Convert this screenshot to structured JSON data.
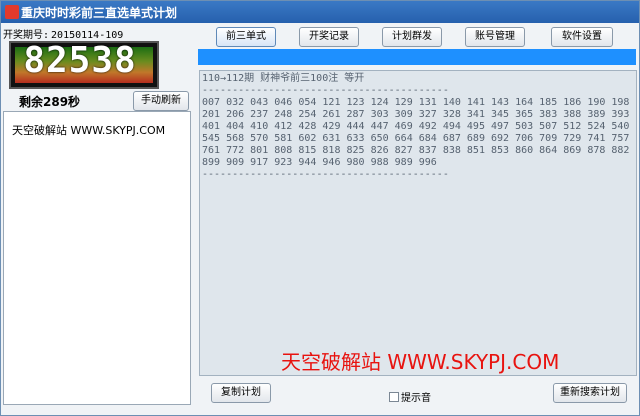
{
  "window": {
    "title": "重庆时时彩前三直选单式计划"
  },
  "draw": {
    "label": "开奖期号:",
    "value": "20150114-109",
    "number": "82538",
    "remaining": "剩余289秒"
  },
  "buttons": {
    "refresh": "手动刷新",
    "tabs": [
      "前三单式",
      "开奖记录",
      "计划群发",
      "账号管理",
      "软件设置"
    ],
    "copy_plan": "复制计划",
    "re_search": "重新搜索计划"
  },
  "left": {
    "text": "天空破解站 WWW.SKYPJ.COM"
  },
  "plan": {
    "header": "110→112期  财神爷前三100注 等开",
    "separator": "-----------------------------------------",
    "numbers": "007 032 043 046 054 121 123 124 129 131 140 141 143 164 185 186 190 198 201 206 237 248 254 261 287 303 309 327 328 341 345 365 383 388 389 393 401 404 410 412 428 429 444 447 469 492 494 495 497 503 507 512 524 540 545 568 570 581 602 631 633 650 664 684 687 689 692 706 709 729 741 757 761 772 801 808 815 818 825 826 827 837 838 851 853 860 864 869 878 882 899 909 917 923 944 946 980 988 989 996"
  },
  "watermark": "天空破解站 WWW.SKYPJ.COM",
  "sound": {
    "label": "提示音",
    "checked": false
  },
  "colors": {
    "titlebar": "#2f6fbf",
    "progress": "#1e90ff",
    "watermark": "#e8130f",
    "led_text": "#ffffff"
  }
}
